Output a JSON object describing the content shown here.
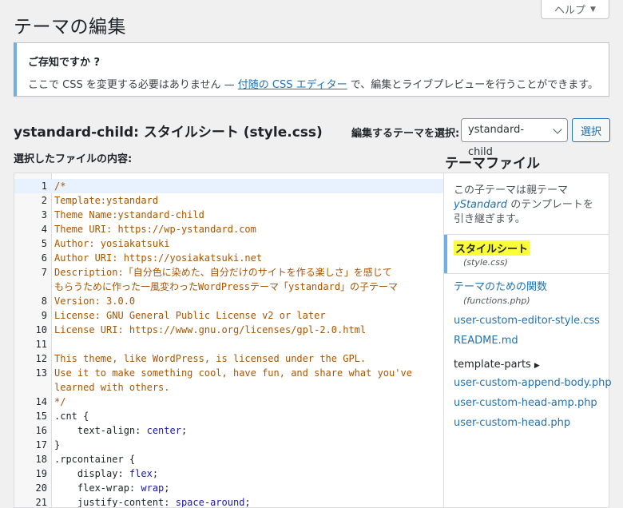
{
  "page_title": "テーマの編集",
  "help": {
    "label": "ヘルプ",
    "caret": "▼"
  },
  "notice": {
    "title": "ご存知ですか ?",
    "text_before": "ここで CSS を変更する必要はありません — ",
    "link": "付随の CSS エディター",
    "text_after": " で、編集とライブプレビューを行うことができます。"
  },
  "file_heading": {
    "theme": "ystandard-child:",
    "name": " スタイルシート (style.css)"
  },
  "theme_select": {
    "label": "編集するテーマを選択:",
    "value": "ystandard-child",
    "button": "選択"
  },
  "content_label": "選択したファイルの内容:",
  "editor": {
    "lines": [
      {
        "n": "1",
        "text": "/*",
        "cls": "cmt"
      },
      {
        "n": "2",
        "text": "Template:ystandard",
        "cls": "cmt"
      },
      {
        "n": "3",
        "text": "Theme Name:ystandard-child",
        "cls": "cmt"
      },
      {
        "n": "4",
        "text": "Theme URI: https://wp-ystandard.com",
        "cls": "cmt"
      },
      {
        "n": "5",
        "text": "Author: yosiakatsuki",
        "cls": "cmt"
      },
      {
        "n": "6",
        "text": "Author URI: https://yosiakatsuki.net",
        "cls": "cmt"
      },
      {
        "n": "7",
        "text": "Description:「自分色に染めた、自分だけのサイトを作る楽しさ」を感じて",
        "cls": "cmt"
      },
      {
        "n": "",
        "text": "もらうために作った一風変わったWordPressテーマ「ystandard」の子テーマ",
        "cls": "cmt"
      },
      {
        "n": "8",
        "text": "Version: 3.0.0",
        "cls": "cmt"
      },
      {
        "n": "9",
        "text": "License: GNU General Public License v2 or later",
        "cls": "cmt"
      },
      {
        "n": "10",
        "text": "License URI: https://www.gnu.org/licenses/gpl-2.0.html",
        "cls": "cmt"
      },
      {
        "n": "11",
        "text": "",
        "cls": "cmt"
      },
      {
        "n": "12",
        "text": "This theme, like WordPress, is licensed under the GPL.",
        "cls": "cmt"
      },
      {
        "n": "13",
        "text": "Use it to make something cool, have fun, and share what you've",
        "cls": "cmt"
      },
      {
        "n": "",
        "text": "learned with others.",
        "cls": "cmt"
      },
      {
        "n": "14",
        "text": "*/",
        "cls": "cmt"
      },
      {
        "n": "15",
        "text": ".cnt {",
        "cls": "plain"
      },
      {
        "n": "16",
        "prop": "    text-align: ",
        "value": "center",
        "end": ";"
      },
      {
        "n": "17",
        "text": "}",
        "cls": "plain"
      },
      {
        "n": "18",
        "text": ".rpcontainer {",
        "cls": "plain"
      },
      {
        "n": "19",
        "prop": "    display: ",
        "value": "flex",
        "end": ";"
      },
      {
        "n": "20",
        "prop": "    flex-wrap: ",
        "value": "wrap",
        "end": ";"
      },
      {
        "n": "21",
        "prop": "    justify-content: ",
        "value": "space-around",
        "end": ";"
      }
    ]
  },
  "sidebar": {
    "title": "テーマファイル",
    "desc_before": "この子テーマは親テーマ ",
    "desc_theme": "yStandard",
    "desc_after": " のテンプレートを引き継ぎます。",
    "current": {
      "name": "スタイルシート",
      "file": "(style.css)"
    },
    "functions": {
      "name": "テーマのための関数",
      "file": "(functions.php)"
    },
    "files": [
      "user-custom-editor-style.css",
      "README.md"
    ],
    "folder": "template-parts",
    "folder_files": [
      "user-custom-append-body.php",
      "user-custom-head-amp.php",
      "user-custom-head.php"
    ]
  }
}
